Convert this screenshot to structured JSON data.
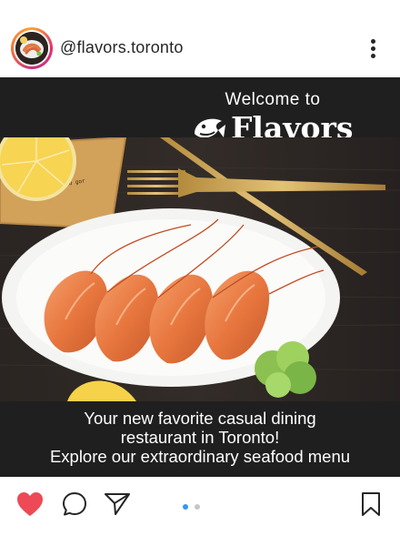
{
  "header": {
    "username": "@flavors.toronto",
    "avatar_icon": "seafood-plate-avatar",
    "more_icon": "more-vertical-icon"
  },
  "post": {
    "welcome_text": "Welcome to",
    "brand_name": "Flavors",
    "brand_icon": "fish-logo-icon",
    "napkin_text": "rique menu gor",
    "caption_lines": [
      "Your new favorite casual dining",
      "restaurant in Toronto!",
      "Explore our extraordinary seafood menu"
    ]
  },
  "actions": {
    "like_icon": "heart-icon",
    "comment_icon": "comment-icon",
    "share_icon": "send-icon",
    "save_icon": "bookmark-icon",
    "carousel_pages": 2,
    "carousel_active": 1,
    "colors": {
      "like": "#ed4956",
      "dot_active": "#3897f0",
      "dot_inactive": "#c7c7c7"
    }
  }
}
